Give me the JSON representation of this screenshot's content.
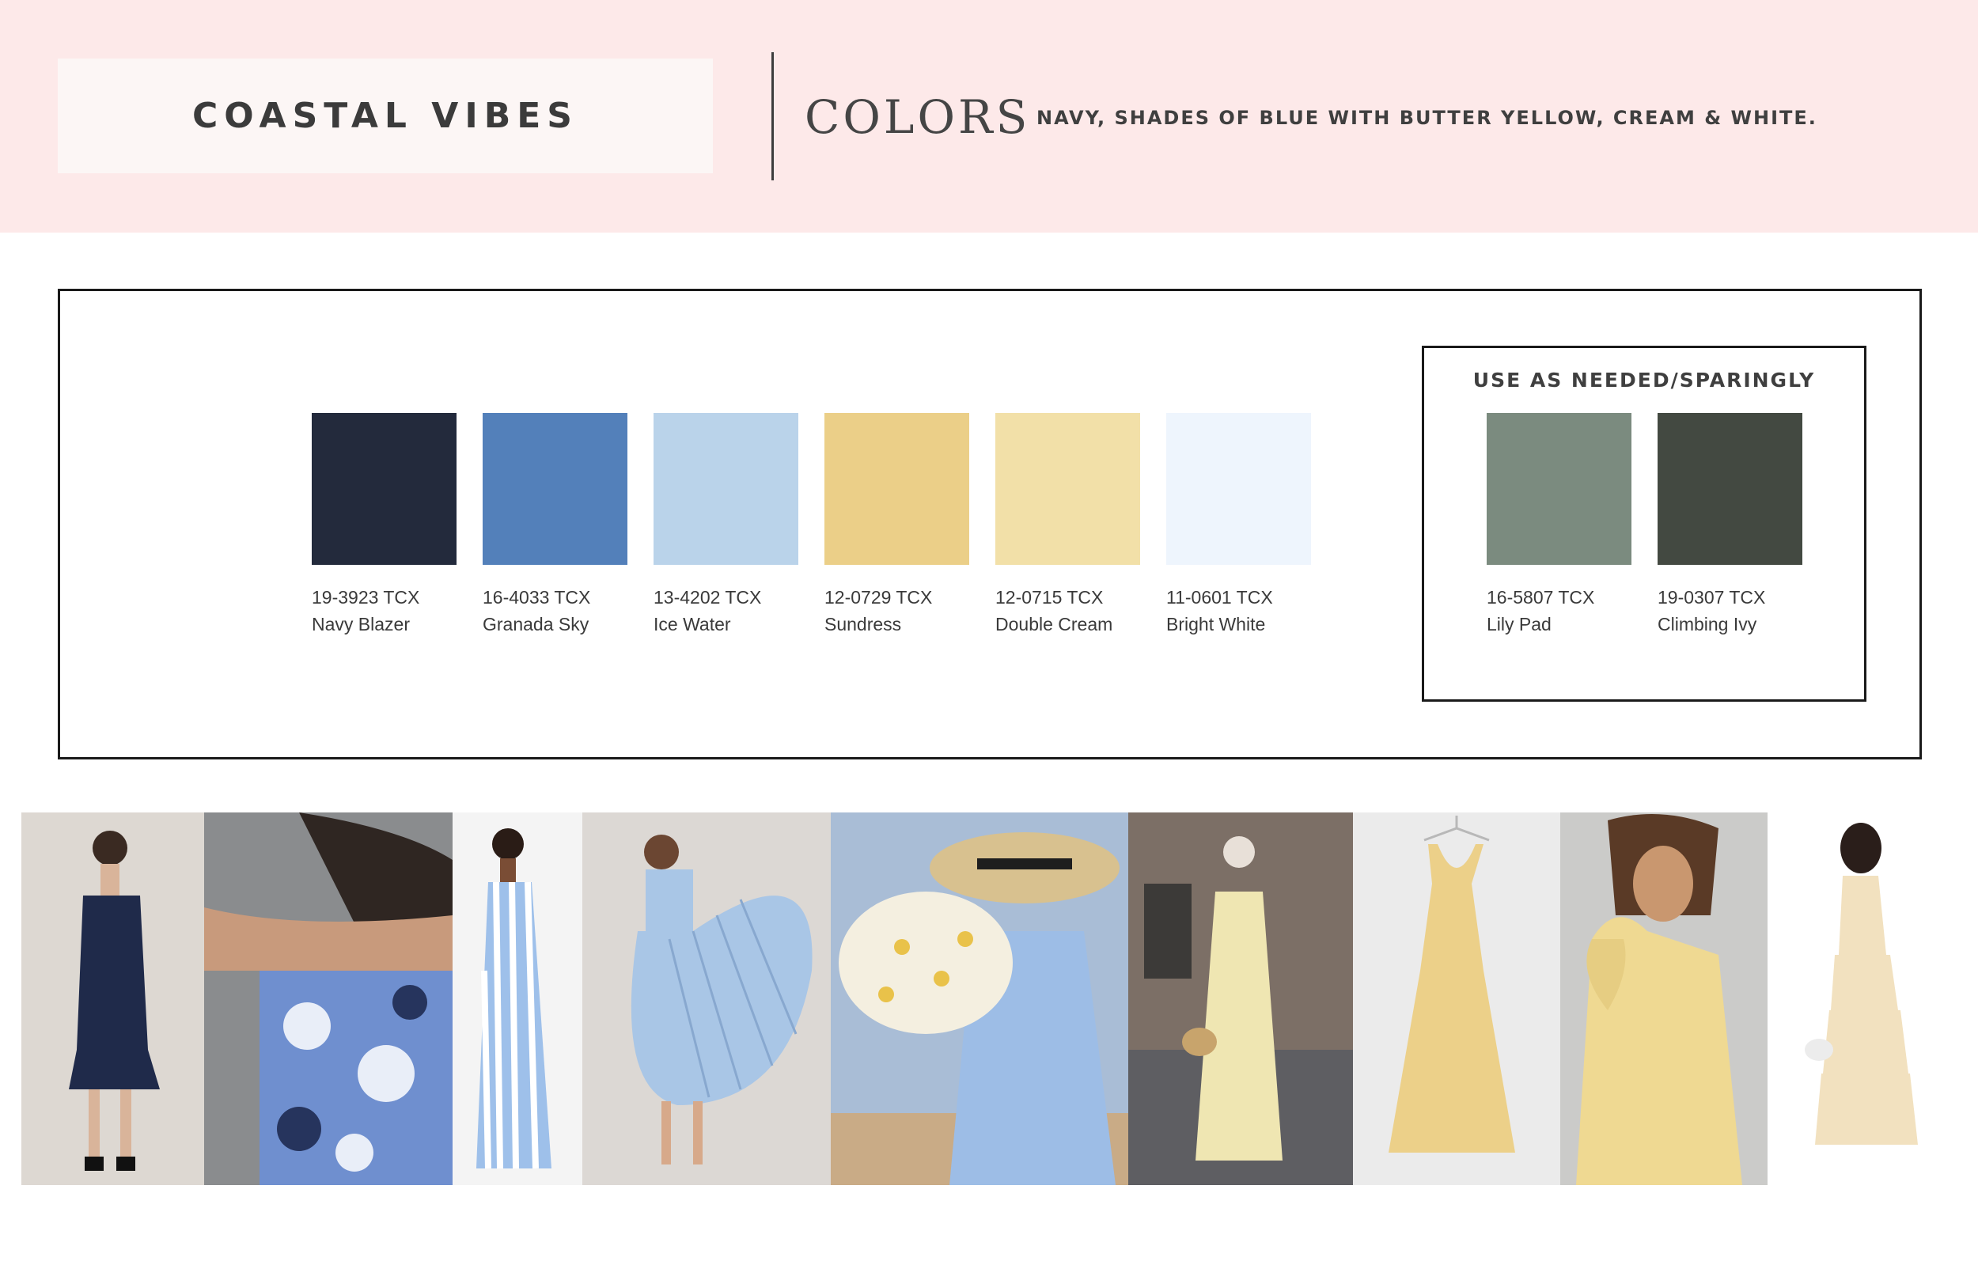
{
  "header": {
    "title": "COASTAL VIBES",
    "colors_heading": "COLORS",
    "description": "NAVY, SHADES OF BLUE WITH BUTTER YELLOW, CREAM & WHITE.",
    "background_color": "#fde9e9"
  },
  "palette": {
    "main": [
      {
        "code": "19-3923 TCX",
        "name": "Navy Blazer",
        "color": "#232a3c"
      },
      {
        "code": "16-4033 TCX",
        "name": "Granada Sky",
        "color": "#5380ba"
      },
      {
        "code": "13-4202 TCX",
        "name": "Ice Water",
        "color": "#bad3ea"
      },
      {
        "code": "12-0729 TCX",
        "name": "Sundress",
        "color": "#ebcf88"
      },
      {
        "code": "12-0715 TCX",
        "name": "Double Cream",
        "color": "#f2e0a8"
      },
      {
        "code": "11-0601 TCX",
        "name": "Bright White",
        "color": "#eef5fd"
      }
    ],
    "sparing_title": "USE AS NEEDED/SPARINGLY",
    "sparing": [
      {
        "code": "16-5807 TCX",
        "name": "Lily Pad",
        "color": "#7b8b7f"
      },
      {
        "code": "19-0307 TCX",
        "name": "Climbing Ivy",
        "color": "#434941"
      }
    ]
  },
  "photos": [
    {
      "subject": "navy midi dress with tiered hem",
      "background": "#ddd8d2",
      "garment": "#1f2a4a"
    },
    {
      "subject": "blue floral embroidered top detail",
      "background": "#8a8c8e",
      "garment": "#6f8fcf"
    },
    {
      "subject": "blue and white striped maxi dress",
      "background": "#f4f4f4",
      "garment": "#9ec0ea"
    },
    {
      "subject": "ice blue pleated skirt and top",
      "background": "#dcd8d4",
      "garment": "#a9c6e6"
    },
    {
      "subject": "woman with straw hat holding daisies",
      "background": "#a9bdd6",
      "garment": "#9dbde6"
    },
    {
      "subject": "butter yellow ruffled slip dress street style",
      "background": "#7c6f66",
      "garment": "#efe6b2"
    },
    {
      "subject": "yellow sleeveless midi dress on hanger",
      "background": "#ebebeb",
      "garment": "#ecd089"
    },
    {
      "subject": "yellow one-shoulder ruffle dress",
      "background": "#cbcbc9",
      "garment": "#efd992"
    },
    {
      "subject": "cream tiered maxi dress",
      "background": "#ffffff",
      "garment": "#f2e1bf"
    }
  ]
}
